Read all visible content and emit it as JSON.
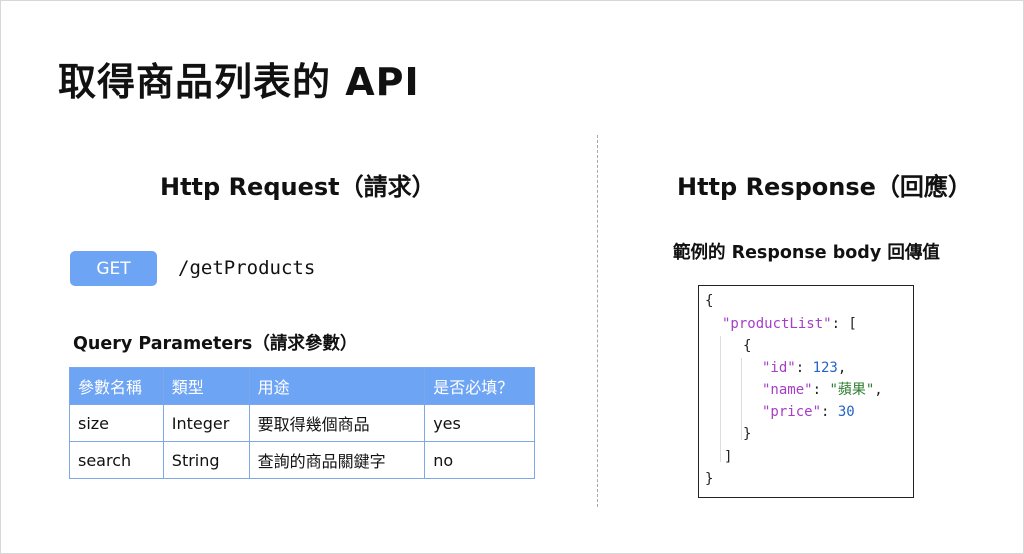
{
  "title": "取得商品列表的 API",
  "request": {
    "heading": "Http Request（請求）",
    "method": "GET",
    "endpoint": "/getProducts",
    "params_heading": "Query Parameters（請求參數）",
    "table": {
      "headers": [
        "參數名稱",
        "類型",
        "用途",
        "是否必填？"
      ],
      "rows": [
        [
          "size",
          "Integer",
          "要取得幾個商品",
          "yes"
        ],
        [
          "search",
          "String",
          "查詢的商品關鍵字",
          "no"
        ]
      ]
    }
  },
  "response": {
    "heading": "Http Response（回應）",
    "subheading": "範例的 Response body 回傳值",
    "code": {
      "open_brace": "{",
      "key_productList": "\"productList\"",
      "colon_bracket": ": [",
      "item_open": "{",
      "key_id": "\"id\"",
      "val_id": "123",
      "key_name": "\"name\"",
      "val_name": "\"蘋果\"",
      "key_price": "\"price\"",
      "val_price": "30",
      "sep": ": ",
      "comma": ",",
      "item_close": "}",
      "bracket_close": "]",
      "close_brace": "}"
    }
  },
  "colors": {
    "accent_blue": "#6ea4f4",
    "json_key": "#a63ec8",
    "json_number": "#2563c9",
    "json_string": "#2e7d32"
  }
}
